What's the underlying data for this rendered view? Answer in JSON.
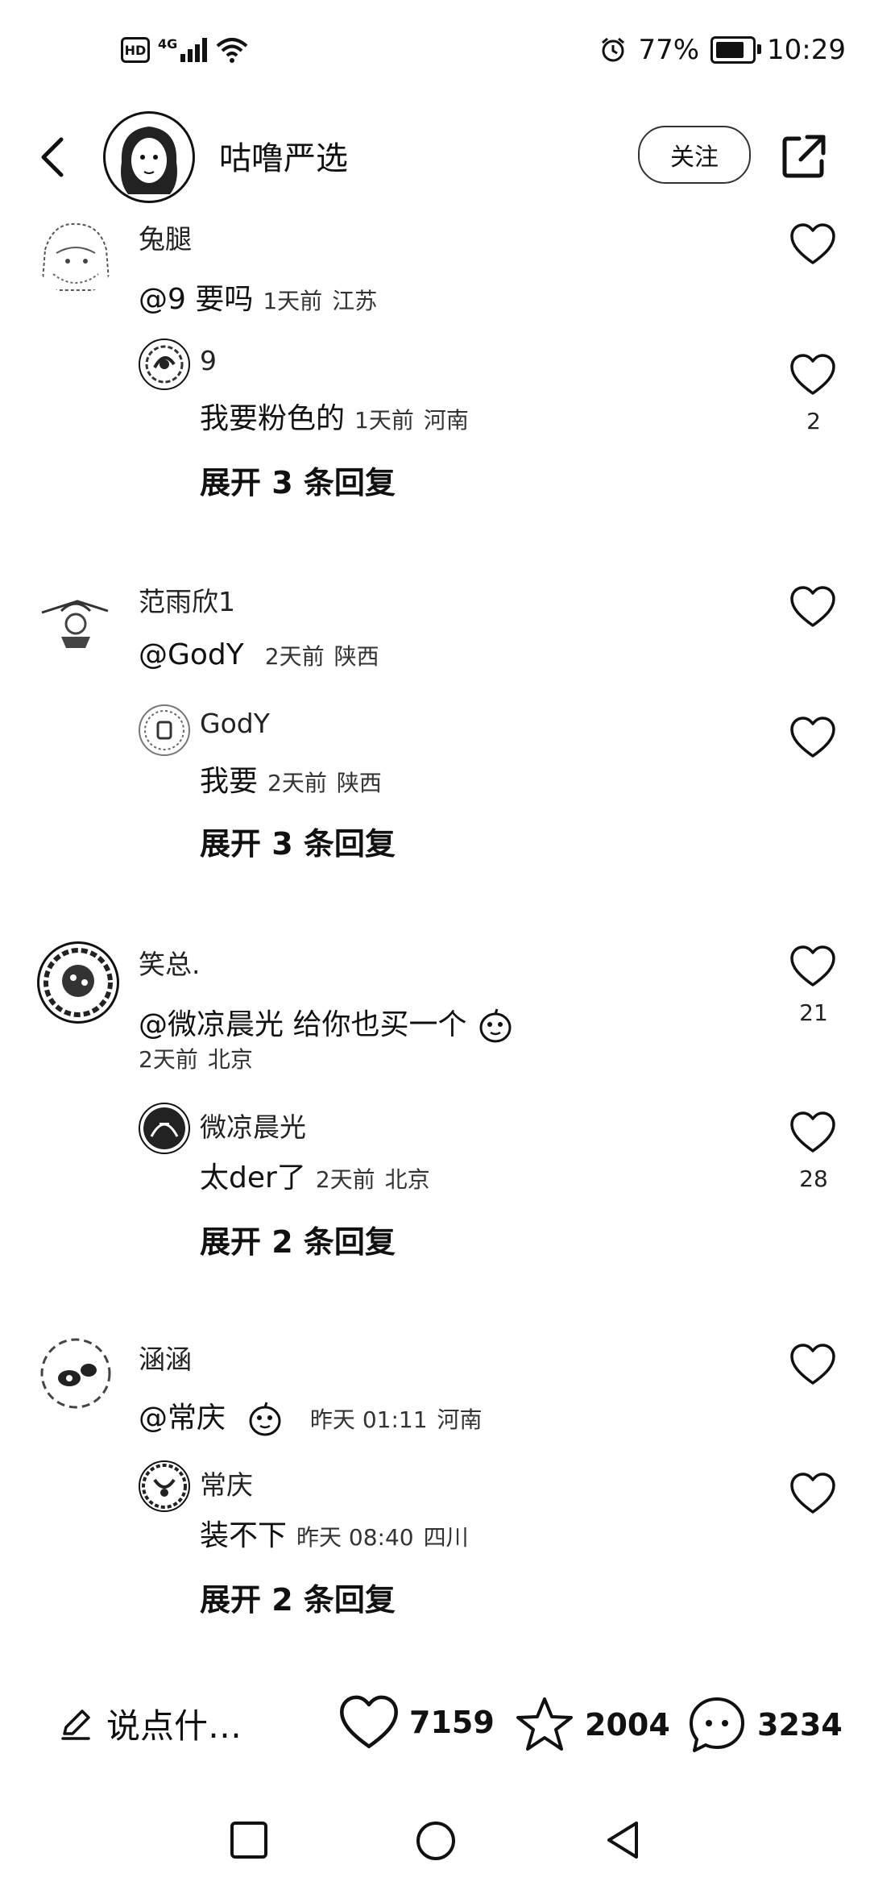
{
  "status_bar": {
    "hd_label": "HD",
    "network": "4G",
    "battery": "77%",
    "time": "10:29"
  },
  "header": {
    "title": "咕噜严选",
    "follow_label": "关注"
  },
  "comments": [
    {
      "user": "兔腿",
      "text": "@9 要吗",
      "time": "1天前",
      "location": "江苏",
      "likes": "",
      "reply": {
        "user": "9",
        "text": "我要粉色的",
        "time": "1天前",
        "location": "河南",
        "likes": "2"
      },
      "expand": "展开 3 条回复"
    },
    {
      "user": "范雨欣1",
      "text": "@GodY",
      "time": "2天前",
      "location": "陕西",
      "likes": "",
      "reply": {
        "user": "GodY",
        "text": "我要",
        "time": "2天前",
        "location": "陕西",
        "likes": ""
      },
      "expand": "展开 3 条回复"
    },
    {
      "user": "笑总.",
      "text": "@微凉晨光 给你也买一个",
      "time": "2天前",
      "location": "北京",
      "likes": "21",
      "reply": {
        "user": "微凉晨光",
        "text": "太der了",
        "time": "2天前",
        "location": "北京",
        "likes": "28"
      },
      "expand": "展开 2 条回复"
    },
    {
      "user": "涵涵",
      "text": "@常庆",
      "time": "昨天 01:11",
      "location": "河南",
      "likes": "",
      "reply": {
        "user": "常庆",
        "text": "装不下",
        "time": "昨天 08:40",
        "location": "四川",
        "likes": ""
      },
      "expand": "展开 2 条回复"
    }
  ],
  "bottom_bar": {
    "input_placeholder": "说点什…",
    "likes": "7159",
    "favorites": "2004",
    "comments": "3234"
  },
  "icons": [
    "back-icon",
    "share-icon",
    "heart-icon",
    "star-icon",
    "comment-icon",
    "pencil-icon",
    "sticker-icon"
  ]
}
